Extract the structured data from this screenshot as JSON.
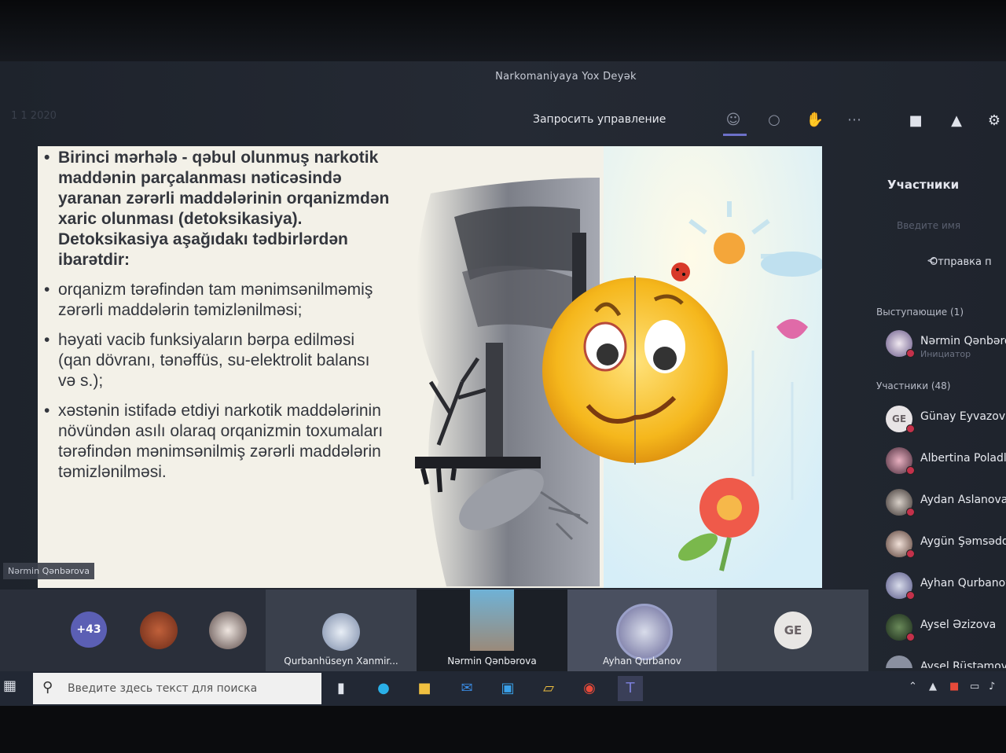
{
  "window": {
    "title": "Narkomaniyaya Yox Deyək",
    "date": "1 1 2020"
  },
  "toolbar": {
    "request_control": "Запросить управление"
  },
  "slide": {
    "bullets": [
      "Birinci mərhələ - qəbul olunmuş narkotik maddənin parçalanması nəticəsində yaranan zərərli maddələrinin orqanizmdən xaric olunması (detoksikasiya). Detoksikasiya aşağıdakı tədbirlərdən ibarətdir:",
      "orqanizm tərəfindən tam mənimsənilməmiş zərərli maddələrin təmizlənilməsi;",
      "həyati vacib funksiyaların bərpa edilməsi (qan dövranı, tənəffüs, su-elektrolit balansı və s.);",
      "xəstənin istifadə etdiyi narkotik maddələrinin növündən asılı olaraq orqanizmin toxumaları tərəfindən mənimsənilmiş zərərli maddələrin təmizlənilməsi."
    ]
  },
  "presenter_tag": "Nərmin Qənbərova",
  "tiles": {
    "more_count": "+43",
    "t1_name": "Qurbanhüseyn Xanmir...",
    "t2_name": "Nərmin Qənbərova",
    "t3_name": "Ayhan Qurbanov",
    "t4_initials": "GE"
  },
  "panel": {
    "title": "Участники",
    "search_placeholder": "Введите имя",
    "share": "Отправка п",
    "presenters_head": "Выступающие (1)",
    "attendees_head": "Участники (48)",
    "presenter": {
      "name": "Nərmin Qənbərova",
      "role": "Инициатор"
    },
    "people": [
      {
        "name": "Günay Eyvazova",
        "initials": "GE"
      },
      {
        "name": "Albertina Poladli",
        "initials": ""
      },
      {
        "name": "Aydan Aslanova",
        "initials": ""
      },
      {
        "name": "Aygün Şəmsəddi",
        "initials": ""
      },
      {
        "name": "Ayhan Qurbanov",
        "initials": ""
      },
      {
        "name": "Aysel Əzizova",
        "initials": ""
      },
      {
        "name": "Aysel Rüstəmova",
        "initials": ""
      }
    ]
  },
  "taskbar": {
    "search_placeholder": "Введите здесь текст для поиска"
  },
  "colors": {
    "teams_purple": "#6264a7",
    "muted_red": "#c4314b",
    "slide_bg": "#f3f1e8"
  }
}
